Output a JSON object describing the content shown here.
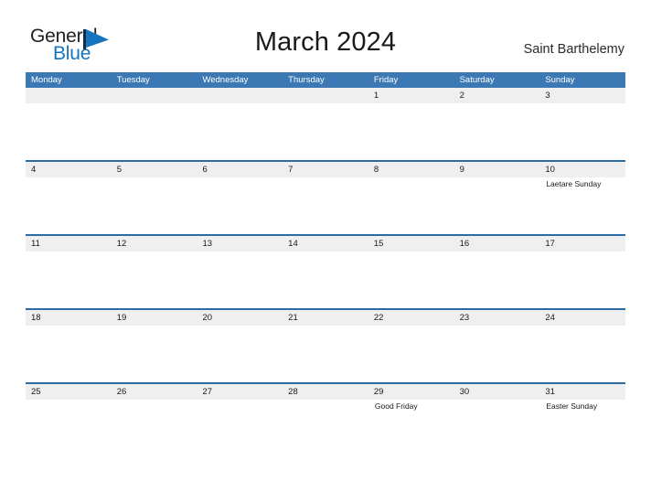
{
  "brand": {
    "name_part1": "General",
    "name_part2": "Blue",
    "flag_icon": "triangle-flag-icon",
    "accent_color": "#1574bf"
  },
  "header": {
    "title": "March 2024",
    "location": "Saint Barthelemy"
  },
  "theme": {
    "header_band": "#3b78b4",
    "row_rule": "#2b6ca3",
    "date_band": "#efefef",
    "text": "#1a1a1a"
  },
  "calendar": {
    "month": "March",
    "year": "2024",
    "weekday_headers": [
      "Monday",
      "Tuesday",
      "Wednesday",
      "Thursday",
      "Friday",
      "Saturday",
      "Sunday"
    ],
    "weeks": [
      [
        {
          "day": "",
          "events": []
        },
        {
          "day": "",
          "events": []
        },
        {
          "day": "",
          "events": []
        },
        {
          "day": "",
          "events": []
        },
        {
          "day": "1",
          "events": []
        },
        {
          "day": "2",
          "events": []
        },
        {
          "day": "3",
          "events": []
        }
      ],
      [
        {
          "day": "4",
          "events": []
        },
        {
          "day": "5",
          "events": []
        },
        {
          "day": "6",
          "events": []
        },
        {
          "day": "7",
          "events": []
        },
        {
          "day": "8",
          "events": []
        },
        {
          "day": "9",
          "events": []
        },
        {
          "day": "10",
          "events": [
            "Laetare Sunday"
          ]
        }
      ],
      [
        {
          "day": "11",
          "events": []
        },
        {
          "day": "12",
          "events": []
        },
        {
          "day": "13",
          "events": []
        },
        {
          "day": "14",
          "events": []
        },
        {
          "day": "15",
          "events": []
        },
        {
          "day": "16",
          "events": []
        },
        {
          "day": "17",
          "events": []
        }
      ],
      [
        {
          "day": "18",
          "events": []
        },
        {
          "day": "19",
          "events": []
        },
        {
          "day": "20",
          "events": []
        },
        {
          "day": "21",
          "events": []
        },
        {
          "day": "22",
          "events": []
        },
        {
          "day": "23",
          "events": []
        },
        {
          "day": "24",
          "events": []
        }
      ],
      [
        {
          "day": "25",
          "events": []
        },
        {
          "day": "26",
          "events": []
        },
        {
          "day": "27",
          "events": []
        },
        {
          "day": "28",
          "events": []
        },
        {
          "day": "29",
          "events": [
            "Good Friday"
          ]
        },
        {
          "day": "30",
          "events": []
        },
        {
          "day": "31",
          "events": [
            "Easter Sunday"
          ]
        }
      ]
    ]
  }
}
